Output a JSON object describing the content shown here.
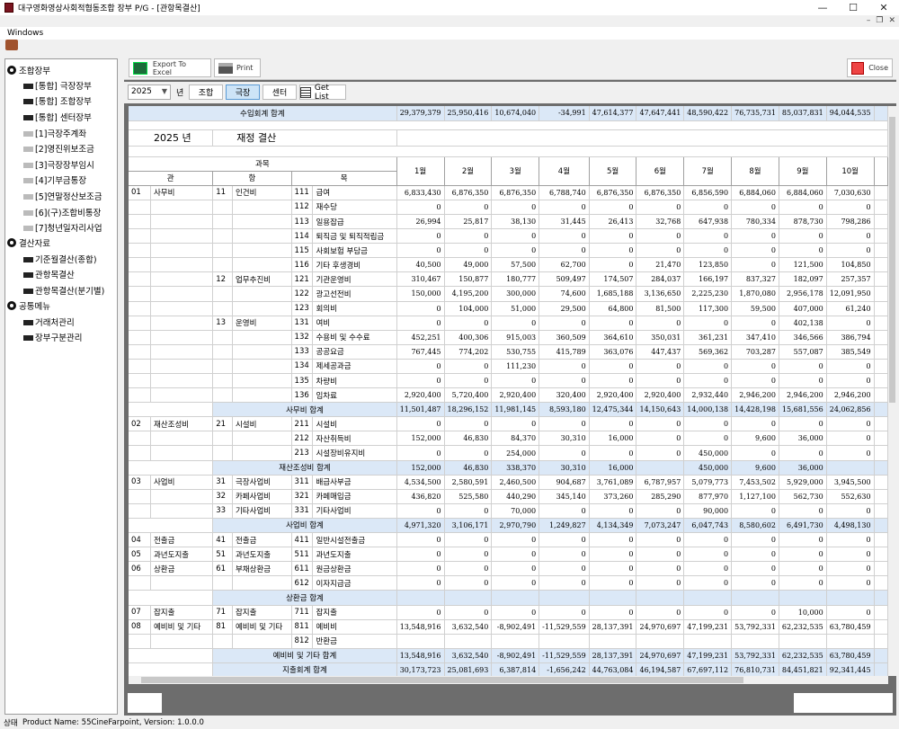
{
  "window": {
    "title": "대구영화영상사회적협동조합 장부 P/G - [관항목결산]",
    "menu": "Windows"
  },
  "sidebar": {
    "groups": [
      {
        "label": "조합장부",
        "items": [
          {
            "label": "[통합] 극장장부",
            "light": false
          },
          {
            "label": "[통합] 조합장부",
            "light": false
          },
          {
            "label": "[통합] 센터장부",
            "light": false
          },
          {
            "label": "[1]극장주계좌",
            "light": true
          },
          {
            "label": "[2]영진위보조금",
            "light": true
          },
          {
            "label": "[3]극장장부임시",
            "light": true
          },
          {
            "label": "[4]기부금통장",
            "light": true
          },
          {
            "label": "[5]연말정산보조금",
            "light": true
          },
          {
            "label": "[6](구)조합비통장",
            "light": true
          },
          {
            "label": "[7]청년일자리사업",
            "light": true
          }
        ]
      },
      {
        "label": "결산자료",
        "items": [
          {
            "label": "기준월결산(종합)",
            "light": false
          },
          {
            "label": "관항목결산",
            "light": false
          },
          {
            "label": "관항목결산(분기별)",
            "light": false
          }
        ]
      },
      {
        "label": "공통메뉴",
        "items": [
          {
            "label": "거래처관리",
            "light": false
          },
          {
            "label": "장부구분관리",
            "light": false
          }
        ]
      }
    ]
  },
  "toolbar": {
    "export": "Export To Excel",
    "print": "Print",
    "close": "Close"
  },
  "filter": {
    "year": "2025",
    "year_label": "년",
    "tabs": [
      "조합",
      "극장",
      "센터"
    ],
    "active_tab": 1,
    "getlist": "Get List"
  },
  "report": {
    "income_total_label": "수입회계 합계",
    "income_total": [
      "29,379,379",
      "25,950,416",
      "10,674,040",
      "-34,991",
      "47,614,377",
      "47,647,441",
      "48,590,422",
      "76,735,731",
      "85,037,831",
      "94,044,535"
    ],
    "year_title": "2025 년",
    "report_title": "재정 결산",
    "h_group": "과목",
    "h_gwan": "관",
    "h_hang": "항",
    "h_mok": "목",
    "months": [
      "1월",
      "2월",
      "3월",
      "4월",
      "5월",
      "6월",
      "7월",
      "8월",
      "9월",
      "10월"
    ],
    "rows": [
      {
        "gc": "01",
        "gn": "사무비",
        "hc": "11",
        "hn": "인건비",
        "mc": "111",
        "mn": "급여",
        "v": [
          "6,833,430",
          "6,876,350",
          "6,876,350",
          "6,788,740",
          "6,876,350",
          "6,876,350",
          "6,856,590",
          "6,884,060",
          "6,884,060",
          "7,030,630"
        ]
      },
      {
        "gc": "",
        "gn": "",
        "hc": "",
        "hn": "",
        "mc": "112",
        "mn": "재수당",
        "v": [
          "0",
          "0",
          "0",
          "0",
          "0",
          "0",
          "0",
          "0",
          "0",
          "0"
        ]
      },
      {
        "gc": "",
        "gn": "",
        "hc": "",
        "hn": "",
        "mc": "113",
        "mn": "일용잡급",
        "v": [
          "26,994",
          "25,817",
          "38,130",
          "31,445",
          "26,413",
          "32,768",
          "647,938",
          "780,334",
          "878,730",
          "798,286"
        ]
      },
      {
        "gc": "",
        "gn": "",
        "hc": "",
        "hn": "",
        "mc": "114",
        "mn": "퇴직금 및 퇴직적립금",
        "v": [
          "0",
          "0",
          "0",
          "0",
          "0",
          "0",
          "0",
          "0",
          "0",
          "0"
        ]
      },
      {
        "gc": "",
        "gn": "",
        "hc": "",
        "hn": "",
        "mc": "115",
        "mn": "사회보험 부담금",
        "v": [
          "0",
          "0",
          "0",
          "0",
          "0",
          "0",
          "0",
          "0",
          "0",
          "0"
        ]
      },
      {
        "gc": "",
        "gn": "",
        "hc": "",
        "hn": "",
        "mc": "116",
        "mn": "기타 후생경비",
        "v": [
          "40,500",
          "49,000",
          "57,500",
          "62,700",
          "0",
          "21,470",
          "123,850",
          "0",
          "121,500",
          "104,850"
        ]
      },
      {
        "gc": "",
        "gn": "",
        "hc": "12",
        "hn": "업무추진비",
        "mc": "121",
        "mn": "기관운영비",
        "v": [
          "310,467",
          "150,877",
          "180,777",
          "509,497",
          "174,507",
          "284,037",
          "166,197",
          "837,327",
          "182,097",
          "257,357"
        ]
      },
      {
        "gc": "",
        "gn": "",
        "hc": "",
        "hn": "",
        "mc": "122",
        "mn": "광고선전비",
        "v": [
          "150,000",
          "4,195,200",
          "300,000",
          "74,600",
          "1,685,188",
          "3,136,650",
          "2,225,230",
          "1,870,080",
          "2,956,178",
          "12,091,950"
        ]
      },
      {
        "gc": "",
        "gn": "",
        "hc": "",
        "hn": "",
        "mc": "123",
        "mn": "회의비",
        "v": [
          "0",
          "104,000",
          "51,000",
          "29,500",
          "64,800",
          "81,500",
          "117,300",
          "59,500",
          "407,000",
          "61,240"
        ]
      },
      {
        "gc": "",
        "gn": "",
        "hc": "13",
        "hn": "운영비",
        "mc": "131",
        "mn": "여비",
        "v": [
          "0",
          "0",
          "0",
          "0",
          "0",
          "0",
          "0",
          "0",
          "402,138",
          "0"
        ]
      },
      {
        "gc": "",
        "gn": "",
        "hc": "",
        "hn": "",
        "mc": "132",
        "mn": "수용비 및 수수료",
        "v": [
          "452,251",
          "400,306",
          "915,003",
          "360,509",
          "364,610",
          "350,031",
          "361,231",
          "347,410",
          "346,566",
          "386,794"
        ]
      },
      {
        "gc": "",
        "gn": "",
        "hc": "",
        "hn": "",
        "mc": "133",
        "mn": "공공요금",
        "v": [
          "767,445",
          "774,202",
          "530,755",
          "415,789",
          "363,076",
          "447,437",
          "569,362",
          "703,287",
          "557,087",
          "385,549"
        ]
      },
      {
        "gc": "",
        "gn": "",
        "hc": "",
        "hn": "",
        "mc": "134",
        "mn": "제세공과금",
        "v": [
          "0",
          "0",
          "111,230",
          "0",
          "0",
          "0",
          "0",
          "0",
          "0",
          "0"
        ]
      },
      {
        "gc": "",
        "gn": "",
        "hc": "",
        "hn": "",
        "mc": "135",
        "mn": "차량비",
        "v": [
          "0",
          "0",
          "0",
          "0",
          "0",
          "0",
          "0",
          "0",
          "0",
          "0"
        ]
      },
      {
        "gc": "",
        "gn": "",
        "hc": "",
        "hn": "",
        "mc": "136",
        "mn": "임차료",
        "v": [
          "2,920,400",
          "5,720,400",
          "2,920,400",
          "320,400",
          "2,920,400",
          "2,920,400",
          "2,932,440",
          "2,946,200",
          "2,946,200",
          "2,946,200"
        ]
      },
      {
        "sum": "사무비 합계",
        "v": [
          "11,501,487",
          "18,296,152",
          "11,981,145",
          "8,593,180",
          "12,475,344",
          "14,150,643",
          "14,000,138",
          "14,428,198",
          "15,681,556",
          "24,062,856"
        ]
      },
      {
        "gc": "02",
        "gn": "재산조성비",
        "hc": "21",
        "hn": "시설비",
        "mc": "211",
        "mn": "시설비",
        "v": [
          "0",
          "0",
          "0",
          "0",
          "0",
          "0",
          "0",
          "0",
          "0",
          "0"
        ]
      },
      {
        "gc": "",
        "gn": "",
        "hc": "",
        "hn": "",
        "mc": "212",
        "mn": "자산취득비",
        "v": [
          "152,000",
          "46,830",
          "84,370",
          "30,310",
          "16,000",
          "0",
          "0",
          "9,600",
          "36,000",
          "0"
        ]
      },
      {
        "gc": "",
        "gn": "",
        "hc": "",
        "hn": "",
        "mc": "213",
        "mn": "시설장비유지비",
        "v": [
          "0",
          "0",
          "254,000",
          "0",
          "0",
          "0",
          "450,000",
          "0",
          "0",
          "0"
        ]
      },
      {
        "sum": "재산조성비 합계",
        "v": [
          "152,000",
          "46,830",
          "338,370",
          "30,310",
          "16,000",
          "",
          "450,000",
          "9,600",
          "36,000",
          ""
        ]
      },
      {
        "gc": "03",
        "gn": "사업비",
        "hc": "31",
        "hn": "극장사업비",
        "mc": "311",
        "mn": "배급사부금",
        "v": [
          "4,534,500",
          "2,580,591",
          "2,460,500",
          "904,687",
          "3,761,089",
          "6,787,957",
          "5,079,773",
          "7,453,502",
          "5,929,000",
          "3,945,500"
        ]
      },
      {
        "gc": "",
        "gn": "",
        "hc": "32",
        "hn": "카페사업비",
        "mc": "321",
        "mn": "카페매입금",
        "v": [
          "436,820",
          "525,580",
          "440,290",
          "345,140",
          "373,260",
          "285,290",
          "877,970",
          "1,127,100",
          "562,730",
          "552,630"
        ]
      },
      {
        "gc": "",
        "gn": "",
        "hc": "33",
        "hn": "기타사업비",
        "mc": "331",
        "mn": "기타사업비",
        "v": [
          "0",
          "0",
          "70,000",
          "0",
          "0",
          "0",
          "90,000",
          "0",
          "0",
          "0"
        ]
      },
      {
        "sum": "사업비 합계",
        "v": [
          "4,971,320",
          "3,106,171",
          "2,970,790",
          "1,249,827",
          "4,134,349",
          "7,073,247",
          "6,047,743",
          "8,580,602",
          "6,491,730",
          "4,498,130"
        ]
      },
      {
        "gc": "04",
        "gn": "전출금",
        "hc": "41",
        "hn": "전출금",
        "mc": "411",
        "mn": "일반시설전출금",
        "v": [
          "0",
          "0",
          "0",
          "0",
          "0",
          "0",
          "0",
          "0",
          "0",
          "0"
        ]
      },
      {
        "gc": "05",
        "gn": "과년도지출",
        "hc": "51",
        "hn": "과년도지출",
        "mc": "511",
        "mn": "과년도지출",
        "v": [
          "0",
          "0",
          "0",
          "0",
          "0",
          "0",
          "0",
          "0",
          "0",
          "0"
        ]
      },
      {
        "gc": "06",
        "gn": "상환금",
        "hc": "61",
        "hn": "부채상환금",
        "mc": "611",
        "mn": "원금상환금",
        "v": [
          "0",
          "0",
          "0",
          "0",
          "0",
          "0",
          "0",
          "0",
          "0",
          "0"
        ]
      },
      {
        "gc": "",
        "gn": "",
        "hc": "",
        "hn": "",
        "mc": "612",
        "mn": "이자지급금",
        "v": [
          "0",
          "0",
          "0",
          "0",
          "0",
          "0",
          "0",
          "0",
          "0",
          "0"
        ]
      },
      {
        "sum": "상환금 합계",
        "v": [
          "",
          "",
          "",
          "",
          "",
          "",
          "",
          "",
          "",
          ""
        ]
      },
      {
        "gc": "07",
        "gn": "잡지출",
        "hc": "71",
        "hn": "잡지출",
        "mc": "711",
        "mn": "잡지출",
        "v": [
          "0",
          "0",
          "0",
          "0",
          "0",
          "0",
          "0",
          "0",
          "10,000",
          "0"
        ]
      },
      {
        "gc": "08",
        "gn": "예비비 및 기타",
        "hc": "81",
        "hn": "예비비 및 기타",
        "mc": "811",
        "mn": "예비비",
        "v": [
          "13,548,916",
          "3,632,540",
          "-8,902,491",
          "-11,529,559",
          "28,137,391",
          "24,970,697",
          "47,199,231",
          "53,792,331",
          "62,232,535",
          "63,780,459"
        ]
      },
      {
        "gc": "",
        "gn": "",
        "hc": "",
        "hn": "",
        "mc": "812",
        "mn": "반환금",
        "v": [
          "",
          "",
          "",
          "",
          "",
          "",
          "",
          "",
          "",
          ""
        ]
      },
      {
        "sum": "예비비 및 기타 합계",
        "v": [
          "13,548,916",
          "3,632,540",
          "-8,902,491",
          "-11,529,559",
          "28,137,391",
          "24,970,697",
          "47,199,231",
          "53,792,331",
          "62,232,535",
          "63,780,459"
        ]
      },
      {
        "sum": "지출회계 합계",
        "v": [
          "30,173,723",
          "25,081,693",
          "6,387,814",
          "-1,656,242",
          "44,763,084",
          "46,194,587",
          "67,697,112",
          "76,810,731",
          "84,451,821",
          "92,341,445"
        ]
      }
    ]
  },
  "status": {
    "label": "상태",
    "text": "Product Name: 55CineFarpoint, Version: 1.0.0.0"
  }
}
